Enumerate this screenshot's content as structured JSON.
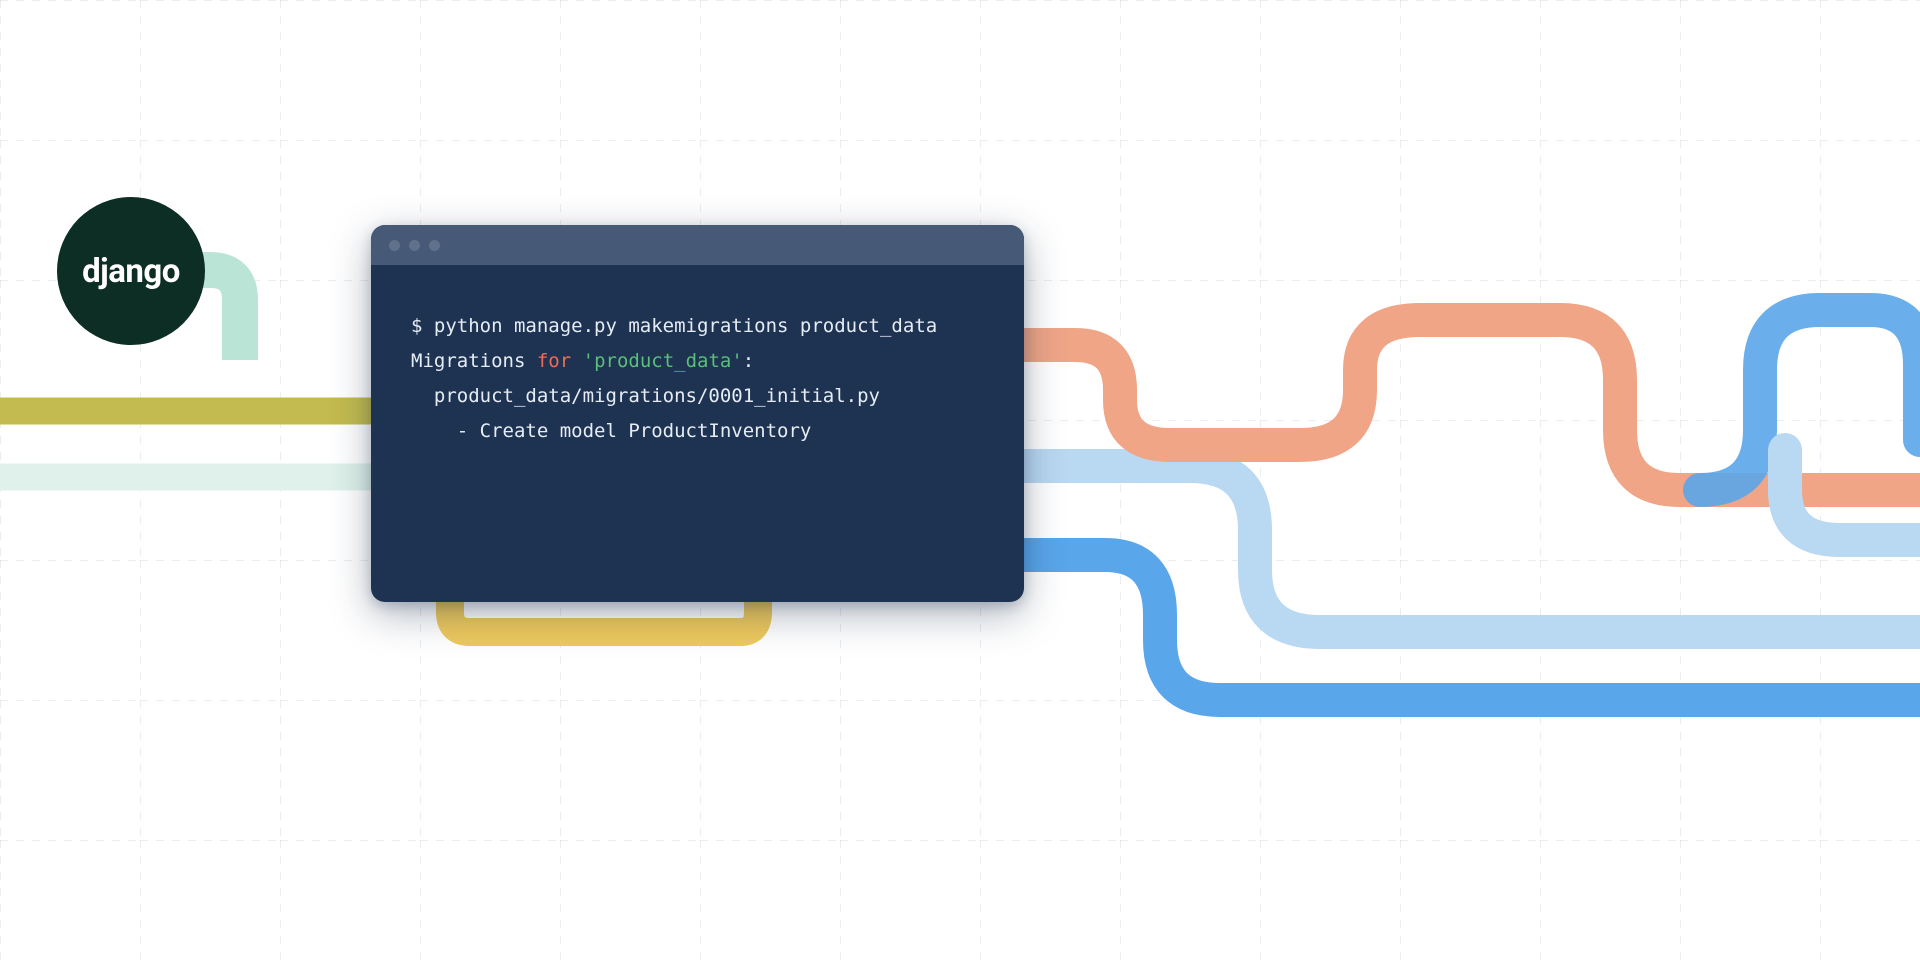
{
  "badge": {
    "label": "django"
  },
  "terminal": {
    "line1_prompt": "$ python manage.py makemigrations product_data",
    "line2_prefix": "Migrations ",
    "line2_for": "for",
    "line2_space": " ",
    "line2_str": "'product_data'",
    "line2_colon": ":",
    "line3": "  product_data/migrations/0001_initial.py",
    "line4": "    - Create model ProductInventory"
  },
  "colors": {
    "terminal_bg": "#1e3252",
    "titlebar": "#465a77",
    "for": "#ef6b56",
    "str": "#5bbf7a",
    "pipe_mint": "#b9e4d6",
    "pipe_olive": "#c3bb4f",
    "pipe_pale": "#dff1ea",
    "pipe_yellow": "#eec95e",
    "pipe_orange": "#f0a587",
    "pipe_blue": "#5aa6ea",
    "pipe_lightblue": "#b9d8f2"
  }
}
